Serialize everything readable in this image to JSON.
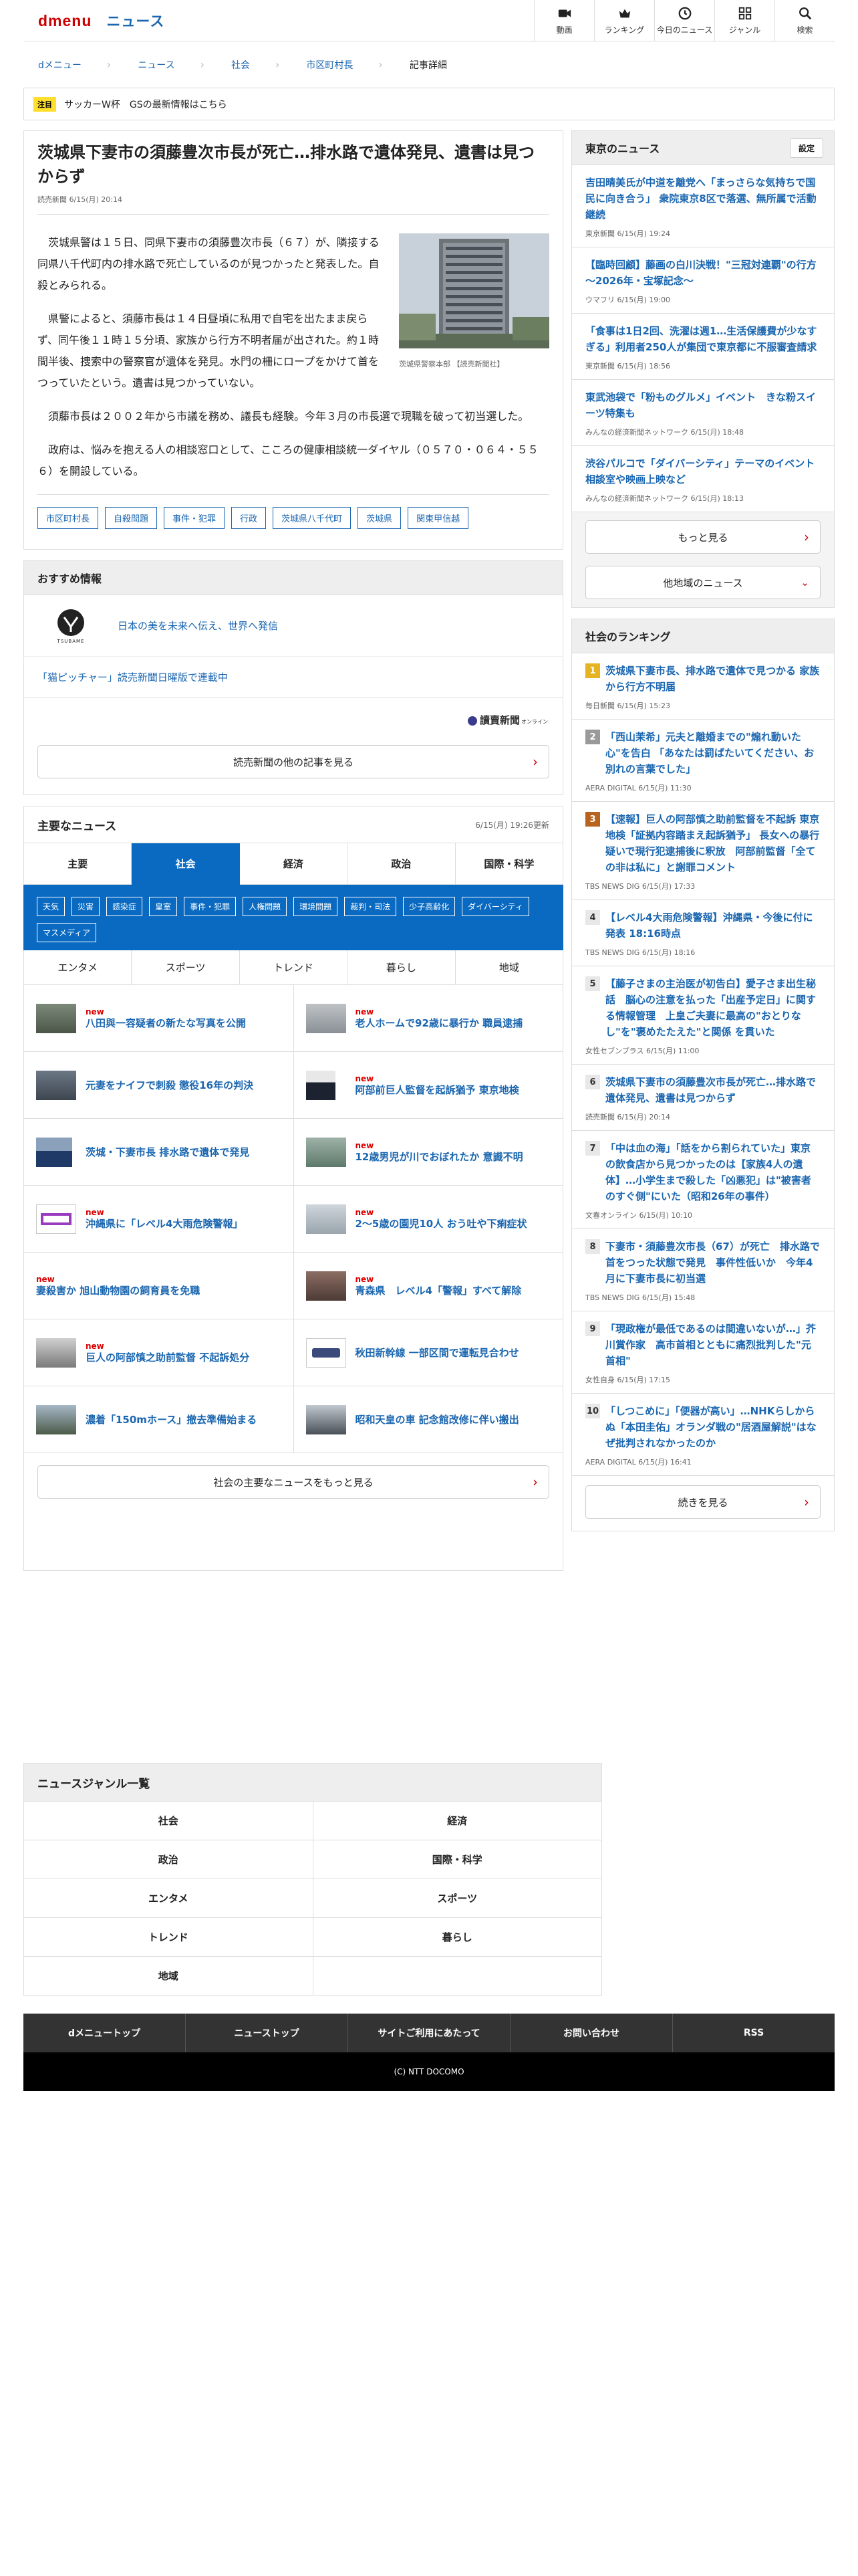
{
  "header": {
    "brand": "dmenu",
    "section": "ニュース",
    "nav": [
      {
        "label": "動画",
        "icon": "video-icon"
      },
      {
        "label": "ランキング",
        "icon": "crown-icon"
      },
      {
        "label": "今日のニュース",
        "icon": "clock-icon"
      },
      {
        "label": "ジャンル",
        "icon": "grid-icon"
      },
      {
        "label": "検索",
        "icon": "search-icon"
      }
    ]
  },
  "breadcrumb": [
    "dメニュー",
    "ニュース",
    "社会",
    "市区町村長",
    "記事詳細"
  ],
  "ticker": {
    "badge": "注目",
    "text": "サッカーW杯　GSの最新情報はこちら"
  },
  "article": {
    "title": "茨城県下妻市の須藤豊次市長が死亡…排水路で遺体発見、遺書は見つからず",
    "meta": "読売新聞 6/15(月) 20:14",
    "photo_caption": "茨城県警察本部 【読売新聞社】",
    "paragraphs": [
      "茨城県警は１５日、同県下妻市の須藤豊次市長（６７）が、隣接する同県八千代町内の排水路で死亡しているのが見つかったと発表した。自殺とみられる。",
      "県警によると、須藤市長は１４日昼頃に私用で自宅を出たまま戻らず、同午後１１時１５分頃、家族から行方不明者届が出された。約１時間半後、捜索中の警察官が遺体を発見。水門の柵にロープをかけて首をつっていたという。遺書は見つかっていない。",
      "須藤市長は２００２年から市議を務め、議長も経験。今年３月の市長選で現職を破って初当選した。",
      "政府は、悩みを抱える人の相談窓口として、こころの健康相談統一ダイヤル（０５７０・０６４・５５６）を開設している。"
    ],
    "tags": [
      "市区町村長",
      "自殺問題",
      "事件・犯罪",
      "行政",
      "茨城県八千代町",
      "茨城県",
      "関東甲信越"
    ]
  },
  "recommend": {
    "heading": "おすすめ情報",
    "item1": "日本の美を未来へ伝え、世界へ発信",
    "item1_logo": "TSUBAME",
    "item2": "「猫ピッチャー」読売新聞日曜版で連載中",
    "publisher_logo": "讀賣新聞",
    "publisher_logo_sub": "オンライン",
    "more_btn": "読売新聞の他の記事を見る"
  },
  "major": {
    "heading": "主要なニュース",
    "updated": "6/15(月) 19:26更新",
    "tabs": [
      "主要",
      "社会",
      "経済",
      "政治",
      "国際・科学"
    ],
    "subcats": [
      "天気",
      "災害",
      "感染症",
      "皇室",
      "事件・犯罪",
      "人権問題",
      "環境問題",
      "裁判・司法",
      "少子高齢化",
      "ダイバーシティ",
      "マスメディア"
    ],
    "tabs2": [
      "エンタメ",
      "スポーツ",
      "トレンド",
      "暮らし",
      "地域"
    ],
    "new_label": "new",
    "items": [
      {
        "title": "八田與一容疑者の新たな写真を公開",
        "new": true
      },
      {
        "title": "老人ホームで92歳に暴行か 職員逮捕",
        "new": true
      },
      {
        "title": "元妻をナイフで刺殺 懲役16年の判決",
        "new": false
      },
      {
        "title": "阿部前巨人監督を起訴猶予 東京地検",
        "new": true
      },
      {
        "title": "茨城・下妻市長 排水路で遺体で発見",
        "new": false
      },
      {
        "title": "12歳男児が川でおぼれたか 意識不明",
        "new": true
      },
      {
        "title": "沖縄県に「レベル4大雨危険警報」",
        "new": true
      },
      {
        "title": "2〜5歳の園児10人 おう吐や下痢症状",
        "new": true
      },
      {
        "title": "妻殺害か 旭山動物園の飼育員を免職",
        "new": true
      },
      {
        "title": "青森県　レベル4「警報」すべて解除",
        "new": true
      },
      {
        "title": "巨人の阿部慎之助前監督 不起訴処分",
        "new": true
      },
      {
        "title": "秋田新幹線 一部区間で運転見合わせ",
        "new": false
      },
      {
        "title": "濃着「150mホース」撤去準備始まる",
        "new": false
      },
      {
        "title": "昭和天皇の車 記念館改修に伴い搬出",
        "new": false
      }
    ],
    "more_btn": "社会の主要なニュースをもっと見る"
  },
  "tokyo": {
    "heading": "東京のニュース",
    "settings": "設定",
    "items": [
      {
        "title": "吉田晴美氏が中道を離党へ「まっさらな気持ちで国民に向き合う」 衆院東京8区で落選、無所属で活動継続",
        "meta": "東京新聞 6/15(月) 19:24"
      },
      {
        "title": "【臨時回顧】藤画の白川決戦！\"三冠対連覇\"の行方～2026年・宝塚記念～",
        "meta": "ウマフリ 6/15(月) 19:00"
      },
      {
        "title": "「食事は1日2回、洗濯は週1…生活保護費が少なすぎる」利用者250人が集団で東京都に不服審査請求",
        "meta": "東京新聞 6/15(月) 18:56"
      },
      {
        "title": "東武池袋で「粉ものグルメ」イベント　きな粉スイーツ特集も",
        "meta": "みんなの経済新聞ネットワーク 6/15(月) 18:48"
      },
      {
        "title": "渋谷パルコで「ダイバーシティ」テーマのイベント　相談室や映画上映など",
        "meta": "みんなの経済新聞ネットワーク 6/15(月) 18:13"
      }
    ],
    "more_btn": "もっと見る",
    "other_btn": "他地域のニュース"
  },
  "ranking": {
    "heading": "社会のランキング",
    "items": [
      {
        "rank": "1",
        "title": "茨城県下妻市長、排水路で遺体で見つかる 家族から行方不明届",
        "meta": "毎日新聞 6/15(月) 15:23",
        "color": "#e6b422"
      },
      {
        "rank": "2",
        "title": "「西山茉希」元夫と離婚までの\"煽れ動いた心\"を告白 「あなたは罰ばたいてください、お別れの言葉でした」",
        "meta": "AERA DIGITAL 6/15(月) 11:30",
        "color": "#9a9a9a"
      },
      {
        "rank": "3",
        "title": "【速報】巨人の阿部慎之助前監督を不起訴 東京地検「証拠内容踏まえ起訴猶予」 長女への暴行疑いで現行犯逮捕後に釈放　阿部前監督「全ての非は私に」と謝罪コメント",
        "meta": "TBS NEWS DIG 6/15(月) 17:33",
        "color": "#b8641e"
      },
      {
        "rank": "4",
        "title": "【レベル4大雨危険警報】沖縄県・今後に付に発表 18:16時点",
        "meta": "TBS NEWS DIG 6/15(月) 18:16",
        "color": "#e8e8e8"
      },
      {
        "rank": "5",
        "title": "【藤子さまの主治医が初告白】愛子さま出生秘話　脳心の注意を払った「出産予定日」に関する情報管理　上皇ご夫妻に最高の\"おとりなし\"を\"褒めたたえた\"と関係 を貫いた",
        "meta": "女性セブンプラス 6/15(月) 11:00",
        "color": "#e8e8e8"
      },
      {
        "rank": "6",
        "title": "茨城県下妻市の須藤豊次市長が死亡…排水路で遺体発見、遺書は見つからず",
        "meta": "読売新聞 6/15(月) 20:14",
        "color": "#e8e8e8"
      },
      {
        "rank": "7",
        "title": "「中は血の海」「話をから割られていた」東京の飲食店から見つかったのは【家族4人の遺体】…小学生まで殺した「凶悪犯」は\"被害者のすぐ側\"にいた（昭和26年の事件）",
        "meta": "文春オンライン 6/15(月) 10:10",
        "color": "#e8e8e8"
      },
      {
        "rank": "8",
        "title": "下妻市・須藤豊次市長（67）が死亡　排水路で首をつった状態で発見　事件性低いか　今年4月に下妻市長に初当選",
        "meta": "TBS NEWS DIG 6/15(月) 15:48",
        "color": "#e8e8e8"
      },
      {
        "rank": "9",
        "title": "「現政権が最低であるのは間違いないが…」芥川賞作家　高市首相とともに痛烈批判した\"元首相\"",
        "meta": "女性自身 6/15(月) 17:15",
        "color": "#e8e8e8"
      },
      {
        "rank": "10",
        "title": "「しつこめに」「便器が高い」…NHKらしからぬ「本田圭佑」オランダ戦の\"居酒屋解説\"はなぜ批判されなかったのか",
        "meta": "AERA DIGITAL 6/15(月) 16:41",
        "color": "#e8e8e8"
      }
    ],
    "more_btn": "続きを見る"
  },
  "genre": {
    "heading": "ニュースジャンル一覧",
    "items": [
      "社会",
      "経済",
      "政治",
      "国際・科学",
      "エンタメ",
      "スポーツ",
      "トレンド",
      "暮らし",
      "地域",
      ""
    ]
  },
  "footer": {
    "links": [
      "dメニュートップ",
      "ニューストップ",
      "サイトご利用にあたって",
      "お問い合わせ",
      "RSS"
    ],
    "copyright": "(C) NTT DOCOMO"
  }
}
